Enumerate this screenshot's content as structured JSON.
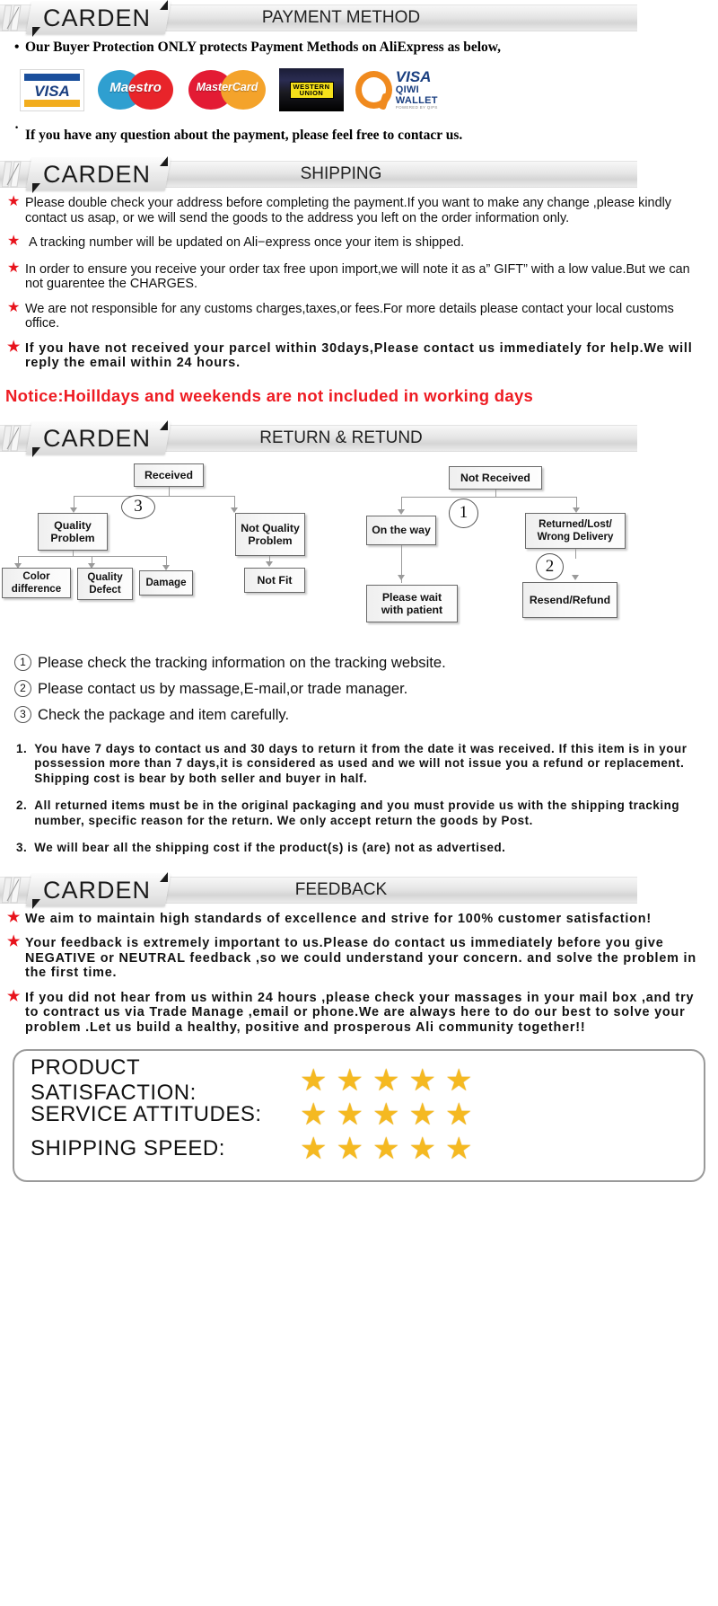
{
  "brand": "CARDEN",
  "sections": {
    "payment": {
      "title": "PAYMENT METHOD",
      "bullet1": "Our Buyer Protection ONLY protects Payment Methods on AliExpress as below,",
      "bullet2": "If you have any question about the payment, please feel free to contacr us.",
      "logos": [
        {
          "name": "visa-logo",
          "label": "VISA"
        },
        {
          "name": "maestro-logo",
          "label": "Maestro"
        },
        {
          "name": "mastercard-logo",
          "label": "MasterCard"
        },
        {
          "name": "western-union-logo",
          "line1": "WESTERN",
          "line2": "UNION"
        },
        {
          "name": "qiwi-wallet-logo",
          "visa": "VISA",
          "wallet": "QIWI WALLET",
          "powered": "POWERED BY QIPS"
        }
      ]
    },
    "shipping": {
      "title": "SHIPPING",
      "items": [
        "Please double check your address before completing the payment.If you want to make any change ,please kindly contact us asap, or we will send the goods to the address you left on the order information only.",
        "A tracking number will be updated on Ali−express once your item is shipped.",
        "In order to ensure you receive your order tax free upon import,we will note it as a” GIFT” with a low value.But we can not guarentee the CHARGES.",
        "We are not responsible for any customs charges,taxes,or fees.For more details please contact your local customs office.",
        "If you have not received your parcel within 30days,Please contact us immediately for help.We will reply the email within 24 hours."
      ],
      "notice": "Notice:Hoilldays and weekends are not included in working days"
    },
    "return": {
      "title": "RETURN & RETUND",
      "flow": {
        "received": "Received",
        "quality_problem": "Quality Problem",
        "not_quality_problem": "Not Quality Problem",
        "color_difference": "Color difference",
        "quality_defect": "Quality Defect",
        "damage": "Damage",
        "not_fit": "Not Fit",
        "not_received": "Not  Received",
        "on_the_way": "On the way",
        "returned_lost": "Returned/Lost/ Wrong Delivery",
        "please_wait": "Please wait with patient",
        "resend_refund": "Resend/Refund",
        "marker1": "1",
        "marker2": "2",
        "marker3": "3"
      },
      "circled": [
        {
          "n": "1",
          "text": "Please check the tracking information on the tracking website."
        },
        {
          "n": "2",
          "text": "Please contact us by  massage,E-mail,or trade manager."
        },
        {
          "n": "3",
          "text": "Check the package and item carefully."
        }
      ],
      "numbered": [
        {
          "n": "1.",
          "text": "You have 7 days to contact us and 30 days to return it from the date it was received. If this item is in your possession more than 7 days,it is considered as used and we will not issue you a refund or replacement. Shipping cost is bear by both seller and buyer in half."
        },
        {
          "n": "2.",
          "text": "All returned items must be in the original packaging and you must provide us with the shipping tracking number, specific reason for the return. We only accept return the goods by Post."
        },
        {
          "n": "3.",
          "text": "We will bear all the shipping cost if the product(s) is (are) not as advertised."
        }
      ]
    },
    "feedback": {
      "title": "FEEDBACK",
      "items": [
        "We aim to maintain high standards of excellence and strive  for 100% customer satisfaction!",
        "Your feedback is extremely important to us.Please do contact us immediately before you give NEGATIVE or NEUTRAL feedback ,so  we could understand your concern. and solve the problem in the first time.",
        "If you did not hear from us within 24 hours ,please check your massages in your mail box ,and try to contract us via Trade Manage ,email or phone.We are always here to do our best to solve your problem .Let us build a healthy, positive and prosperous Ali community together!!"
      ],
      "ratings": [
        {
          "label": "PRODUCT SATISFACTION:",
          "stars": 5
        },
        {
          "label": "SERVICE  ATTITUDES:",
          "stars": 5
        },
        {
          "label": "SHIPPING SPEED:",
          "stars": 5
        }
      ],
      "star_glyph": "★"
    }
  },
  "colors": {
    "star_red": "#e8131c",
    "notice_red": "#ee1b22",
    "rating_star": "#f5b921"
  }
}
